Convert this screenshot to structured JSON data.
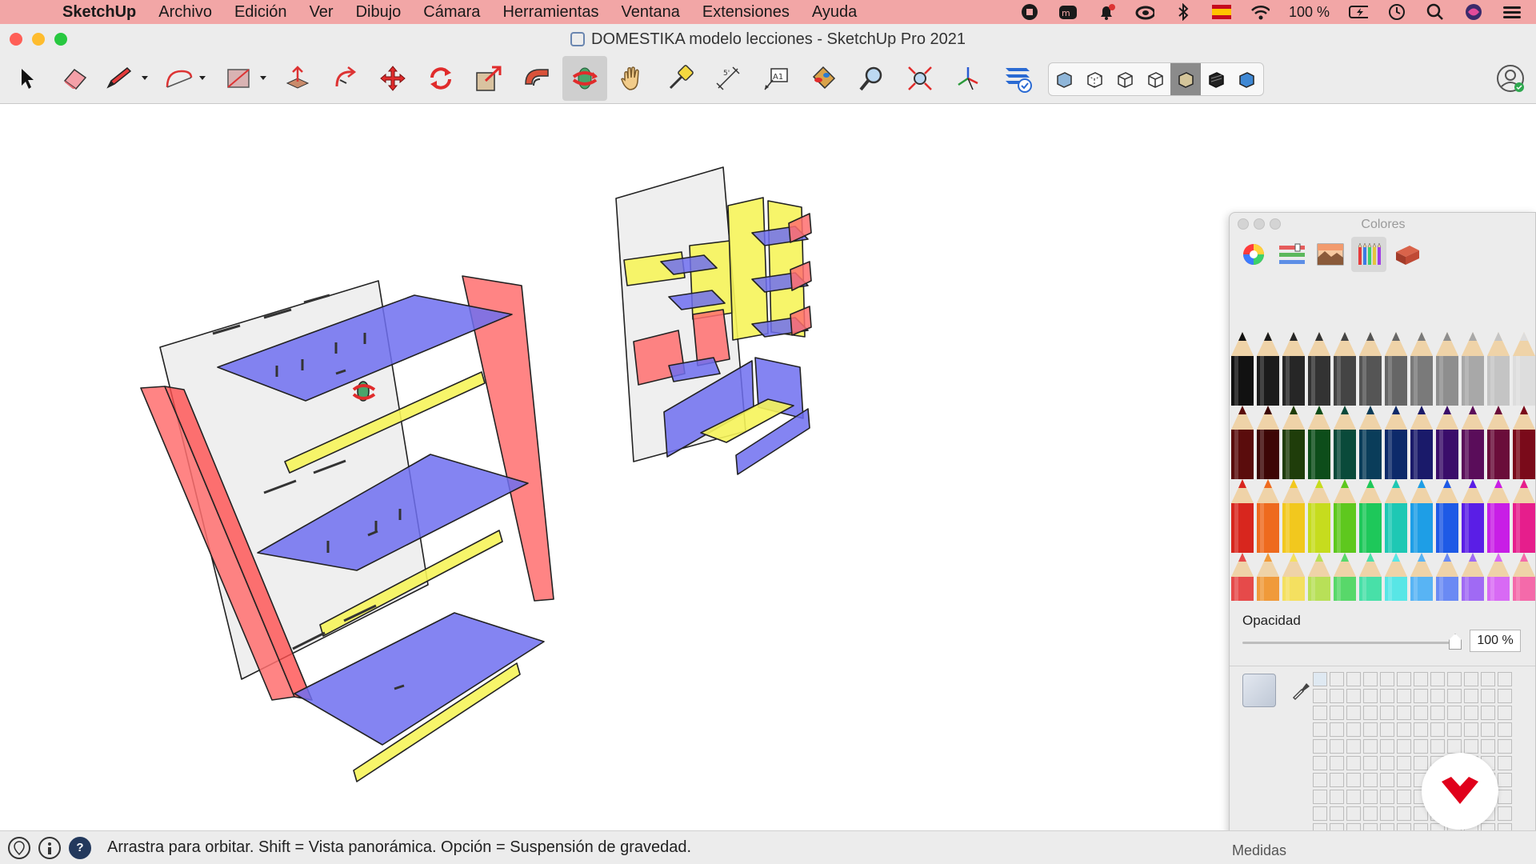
{
  "menubar": {
    "app_name": "SketchUp",
    "items": [
      "Archivo",
      "Edición",
      "Ver",
      "Dibujo",
      "Cámara",
      "Herramientas",
      "Ventana",
      "Extensiones",
      "Ayuda"
    ],
    "battery": "100 %"
  },
  "window": {
    "title": "DOMESTIKA modelo lecciones - SketchUp Pro 2021"
  },
  "toolbar": {
    "tools": [
      "select",
      "eraser",
      "line",
      "arc",
      "rectangle",
      "push-pull",
      "follow-me",
      "move",
      "rotate",
      "scale",
      "offset",
      "orbit",
      "pan",
      "tape-measure",
      "dimension",
      "text",
      "paint-bucket",
      "zoom",
      "zoom-extents",
      "axes",
      "section"
    ],
    "active_tool": "orbit",
    "styles": [
      "x-ray",
      "back-edges",
      "wireframe",
      "hidden-line",
      "shaded",
      "shaded-with-textures",
      "monochrome"
    ],
    "active_style": "shaded"
  },
  "statusbar": {
    "hint": "Arrastra para orbitar. Shift = Vista panorámica. Opción = Suspensión de gravedad.",
    "measurements_label": "Medidas"
  },
  "colors_panel": {
    "title": "Colores",
    "tabs": [
      "color-wheel",
      "color-sliders",
      "color-palettes",
      "image-palettes",
      "pencils"
    ],
    "active_tab": "pencils",
    "opacity_label": "Opacidad",
    "opacity_value": "100 %",
    "opacity": 1.0,
    "model_colors": {
      "frame_red": "#ff6f6f",
      "shelf_blue": "#6e6ef0",
      "bar_yellow": "#f6f45a",
      "back_grey": "#d6d6d6"
    }
  }
}
